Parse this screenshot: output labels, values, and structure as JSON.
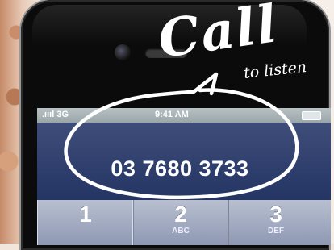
{
  "headline": {
    "main": "Call",
    "sub": "to listen"
  },
  "status_bar": {
    "signal": ".ıııl 3G",
    "time": "9:41 AM"
  },
  "display": {
    "number": "03 7680 3733"
  },
  "keypad": [
    {
      "digit": "1",
      "letters": ""
    },
    {
      "digit": "2",
      "letters": "ABC"
    },
    {
      "digit": "3",
      "letters": "DEF"
    }
  ],
  "colors": {
    "display_bg": "#2b3a68",
    "keypad_bg": "#9ea8c2",
    "phone_body": "#0b0b0b",
    "bubble_outline": "#ffffff"
  }
}
